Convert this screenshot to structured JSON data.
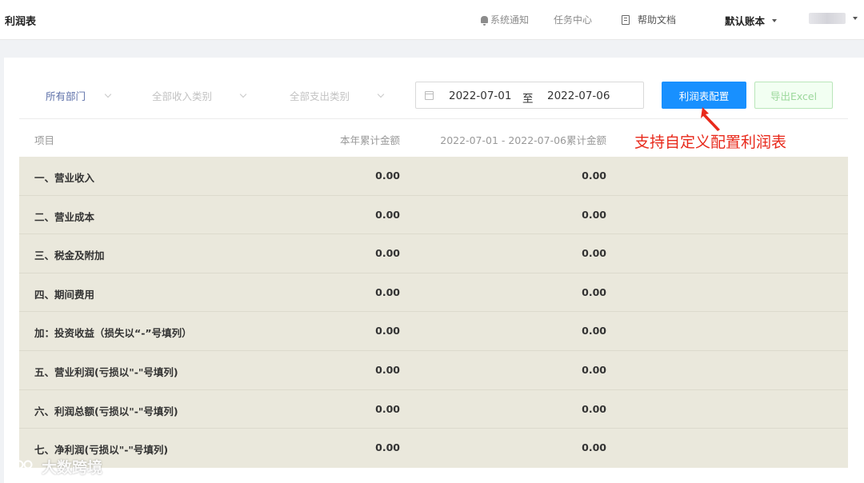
{
  "header": {
    "title": "利润表",
    "notify_label": "系统通知",
    "tasks_label": "任务中心",
    "help_label": "帮助文档",
    "account_label": "默认账本"
  },
  "filters": {
    "department": "所有部门",
    "income_type": "全部收入类别",
    "expense_type": "全部支出类别",
    "date_start": "2022-07-01",
    "date_separator": "至",
    "date_end": "2022-07-06",
    "config_button": "利润表配置",
    "export_button": "导出Excel"
  },
  "annotation": "支持自定义配置利润表",
  "table": {
    "columns": [
      "项目",
      "本年累计金额",
      "2022-07-01 - 2022-07-06累计金额"
    ],
    "rows": [
      {
        "name": "一、营业收入",
        "ytd": "0.00",
        "period": "0.00"
      },
      {
        "name": "二、营业成本",
        "ytd": "0.00",
        "period": "0.00"
      },
      {
        "name": "三、税金及附加",
        "ytd": "0.00",
        "period": "0.00"
      },
      {
        "name": "四、期间费用",
        "ytd": "0.00",
        "period": "0.00"
      },
      {
        "name": "加：投资收益（损失以“-”号填列）",
        "ytd": "0.00",
        "period": "0.00"
      },
      {
        "name": "五、营业利润(亏损以\"-\"号填列)",
        "ytd": "0.00",
        "period": "0.00"
      },
      {
        "name": "六、利润总额(亏损以\"-\"号填列)",
        "ytd": "0.00",
        "period": "0.00"
      },
      {
        "name": "七、净利润(亏损以\"-\"号填列)",
        "ytd": "0.00",
        "period": "0.00"
      }
    ]
  },
  "watermark": "大数跨境",
  "colors": {
    "primary": "#1890ff",
    "annotation": "#e8291b",
    "table_body": "#eae8dc",
    "export_text": "#9cd89c"
  }
}
